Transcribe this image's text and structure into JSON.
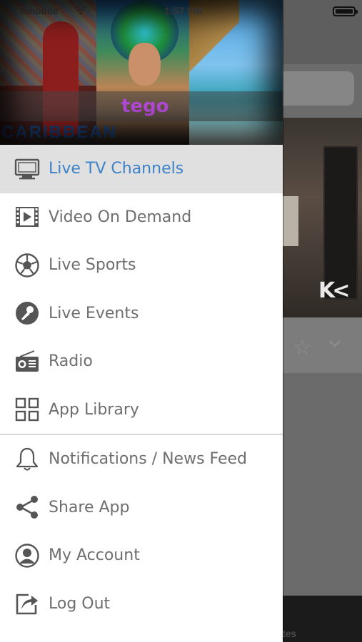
{
  "status_bar": {
    "carrier": "bmobile",
    "time": "1:57 PM"
  },
  "hero": {
    "brand": "tego",
    "banner_text": "CARIBBEAN"
  },
  "menu": {
    "items": [
      {
        "label": "Live TV Channels",
        "icon": "tv-icon",
        "active": true
      },
      {
        "label": "Video On Demand",
        "icon": "film-icon",
        "active": false
      },
      {
        "label": "Live Sports",
        "icon": "soccer-ball-icon",
        "active": false
      },
      {
        "label": "Live Events",
        "icon": "microphone-icon",
        "active": false
      },
      {
        "label": "Radio",
        "icon": "radio-icon",
        "active": false
      },
      {
        "label": "App Library",
        "icon": "grid-icon",
        "active": false
      },
      {
        "label": "Notifications / News Feed",
        "icon": "bell-icon",
        "active": false
      },
      {
        "label": "Share App",
        "icon": "share-icon",
        "active": false
      },
      {
        "label": "My Account",
        "icon": "user-icon",
        "active": false
      },
      {
        "label": "Log Out",
        "icon": "logout-icon",
        "active": false
      }
    ]
  },
  "background": {
    "bottom_tab_label": "tes"
  },
  "colors": {
    "accent": "#3d82c8",
    "active_row": "#e0e0e0",
    "icon_gray": "#555555",
    "label_gray": "#6e6e6e"
  }
}
